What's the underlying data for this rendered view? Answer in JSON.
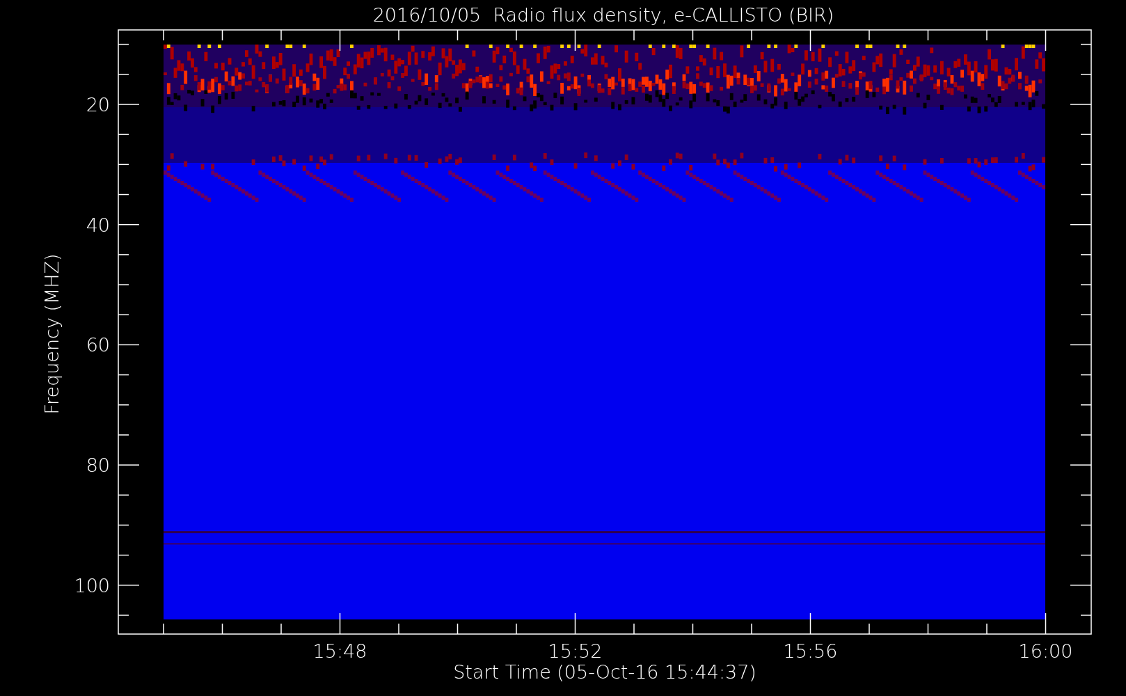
{
  "title": "2016/10/05  Radio flux density, e-CALLISTO (BIR)",
  "plot": {
    "ylabel": "Frequency (MHZ)",
    "xlabel": "Start Time (05-Oct-16 15:44:37)",
    "y_tick_labels": [
      "20",
      "40",
      "60",
      "80",
      "100"
    ],
    "x_tick_labels": [
      "15:48",
      "15:52",
      "15:56",
      "16:00"
    ]
  }
}
